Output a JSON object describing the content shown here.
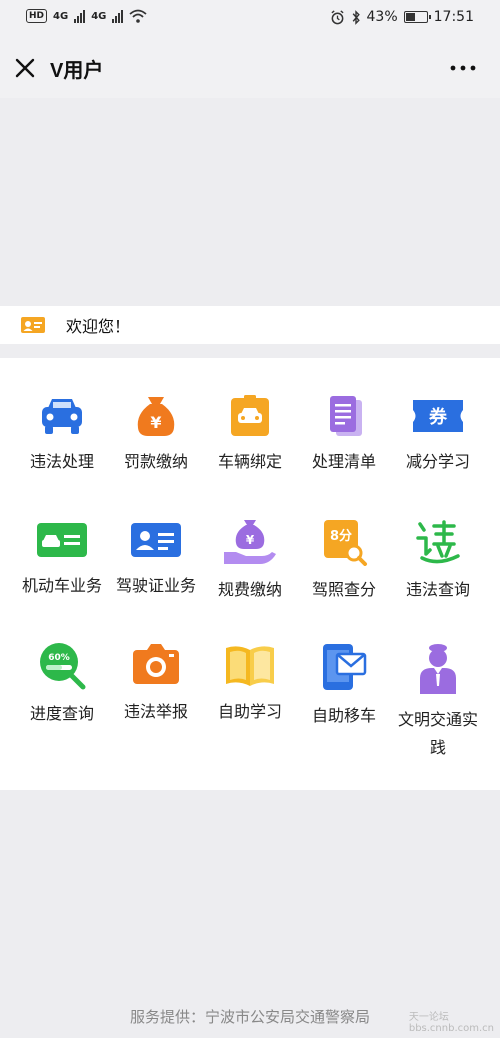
{
  "status_bar": {
    "left": "HD 4G 4G",
    "battery": "43%",
    "time": "17:51"
  },
  "nav": {
    "title": "V用户",
    "close_icon": "close-icon",
    "more_icon": "more-icon"
  },
  "welcome": {
    "text": "欢迎您！",
    "icon": "id-card-icon"
  },
  "grid": {
    "items": [
      {
        "label": "违法处理",
        "icon": "car-icon",
        "color": "#2a6fe0"
      },
      {
        "label": "罚款缴纳",
        "icon": "money-bag-icon",
        "color": "#f07a1e"
      },
      {
        "label": "车辆绑定",
        "icon": "car-badge-icon",
        "color": "#f5a623"
      },
      {
        "label": "处理清单",
        "icon": "document-list-icon",
        "color": "#9b6ce0"
      },
      {
        "label": "减分学习",
        "icon": "coupon-icon",
        "color": "#2a6fe0"
      },
      {
        "label": "机动车业务",
        "icon": "vehicle-card-icon",
        "color": "#2db84a"
      },
      {
        "label": "驾驶证业务",
        "icon": "license-card-icon",
        "color": "#2a6fe0"
      },
      {
        "label": "规费缴纳",
        "icon": "hand-money-icon",
        "color": "#9b6ce0"
      },
      {
        "label": "驾照查分",
        "icon": "score-search-icon",
        "color": "#f5a623"
      },
      {
        "label": "违法查询",
        "icon": "violation-query-icon",
        "color": "#2db84a"
      },
      {
        "label": "进度查询",
        "icon": "progress-search-icon",
        "color": "#2db84a"
      },
      {
        "label": "违法举报",
        "icon": "camera-icon",
        "color": "#f07a1e"
      },
      {
        "label": "自助学习",
        "icon": "book-icon",
        "color": "#f5b820"
      },
      {
        "label": "自助移车",
        "icon": "phone-message-icon",
        "color": "#2a6fe0"
      },
      {
        "label": "文明交通实践",
        "icon": "officer-icon",
        "color": "#9b6ce0"
      }
    ],
    "badges": {
      "coupon": "券",
      "score": "8分",
      "progress": "60%",
      "yen": "¥"
    }
  },
  "footer": {
    "text": "服务提供：宁波市公安局交通警察局"
  },
  "watermark": {
    "line1": "天一论坛",
    "line2": "bbs.cnnb.com.cn"
  }
}
